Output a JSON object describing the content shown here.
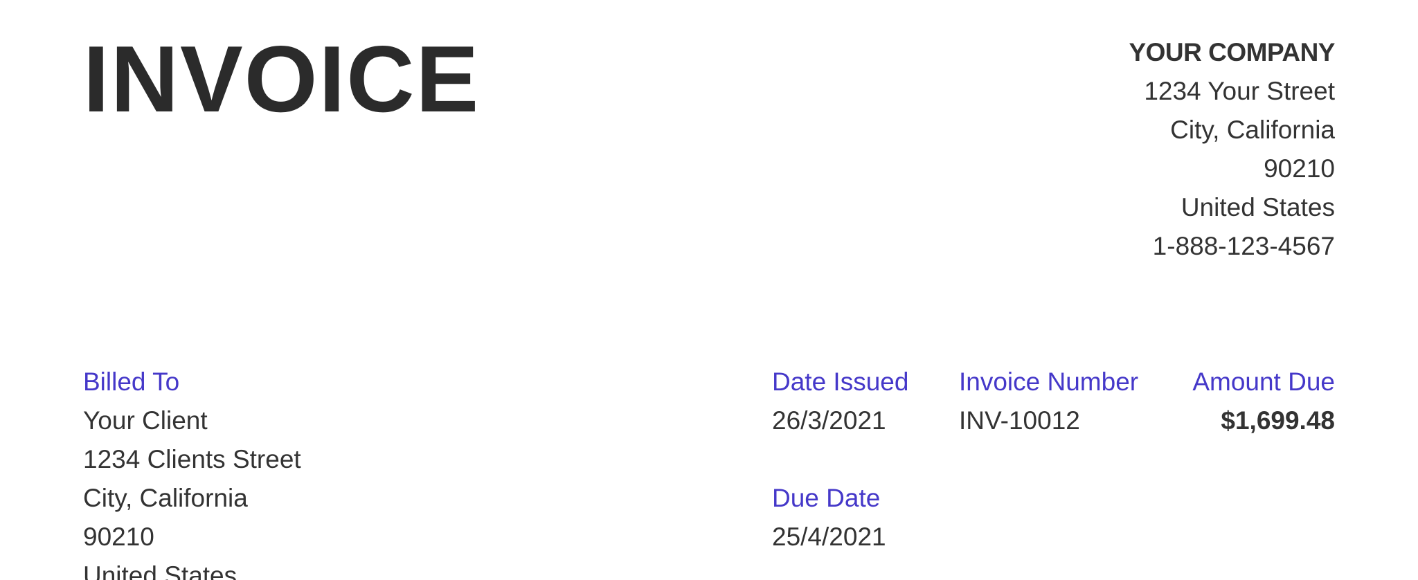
{
  "invoice": {
    "title": "INVOICE"
  },
  "company": {
    "name": "YOUR COMPANY",
    "street": "1234 Your Street",
    "city_state": "City, California",
    "zip": "90210",
    "country": "United States",
    "phone": "1-888-123-4567"
  },
  "billed_to": {
    "label": "Billed To",
    "name": "Your Client",
    "street": "1234 Clients Street",
    "city_state": "City, California",
    "zip": "90210",
    "country": "United States"
  },
  "date_issued": {
    "label": "Date Issued",
    "value": "26/3/2021"
  },
  "due_date": {
    "label": "Due Date",
    "value": "25/4/2021"
  },
  "invoice_number": {
    "label": "Invoice Number",
    "value": "INV-10012"
  },
  "amount_due": {
    "label": "Amount Due",
    "value": "$1,699.48"
  },
  "colors": {
    "label_accent": "#4538c9",
    "text": "#333333",
    "title": "#2b2b2b"
  }
}
